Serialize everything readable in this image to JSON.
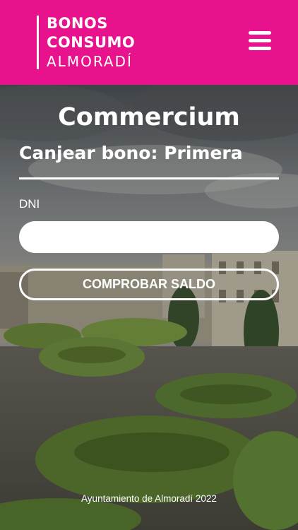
{
  "header": {
    "logo": {
      "line1": "BONOS",
      "line2": "CONSUMO",
      "line3": "ALMORADÍ"
    },
    "menu_icon": "hamburger-menu-icon",
    "background_color": "#e8128c"
  },
  "main": {
    "title": "Commercium",
    "subtitle": "Canjear bono: Primera",
    "dni_label": "DNI",
    "dni_value": "",
    "check_button": "COMPROBAR SALDO"
  },
  "footer": {
    "text": "Ayuntamiento de Almoradí 2022"
  }
}
